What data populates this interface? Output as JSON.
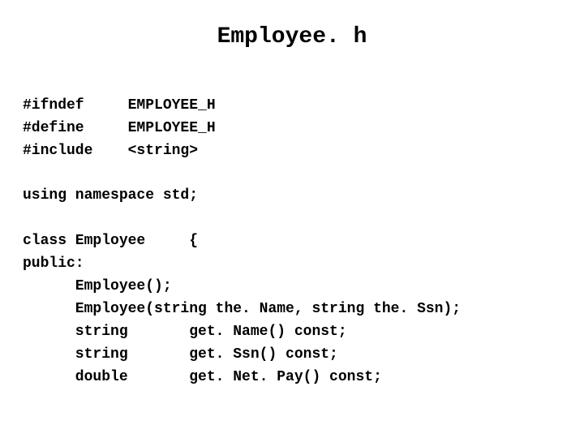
{
  "title": "Employee. h",
  "lines": {
    "l1": "#ifndef     EMPLOYEE_H",
    "l2": "#define     EMPLOYEE_H",
    "l3": "#include    <string>",
    "blank1": "",
    "l4": "using namespace std;",
    "blank2": "",
    "l5": "class Employee     {",
    "l6": "public:",
    "l7": "      Employee();",
    "l8": "      Employee(string the. Name, string the. Ssn);",
    "l9": "      string       get. Name() const;",
    "l10": "      string       get. Ssn() const;",
    "l11": "      double       get. Net. Pay() const;"
  }
}
